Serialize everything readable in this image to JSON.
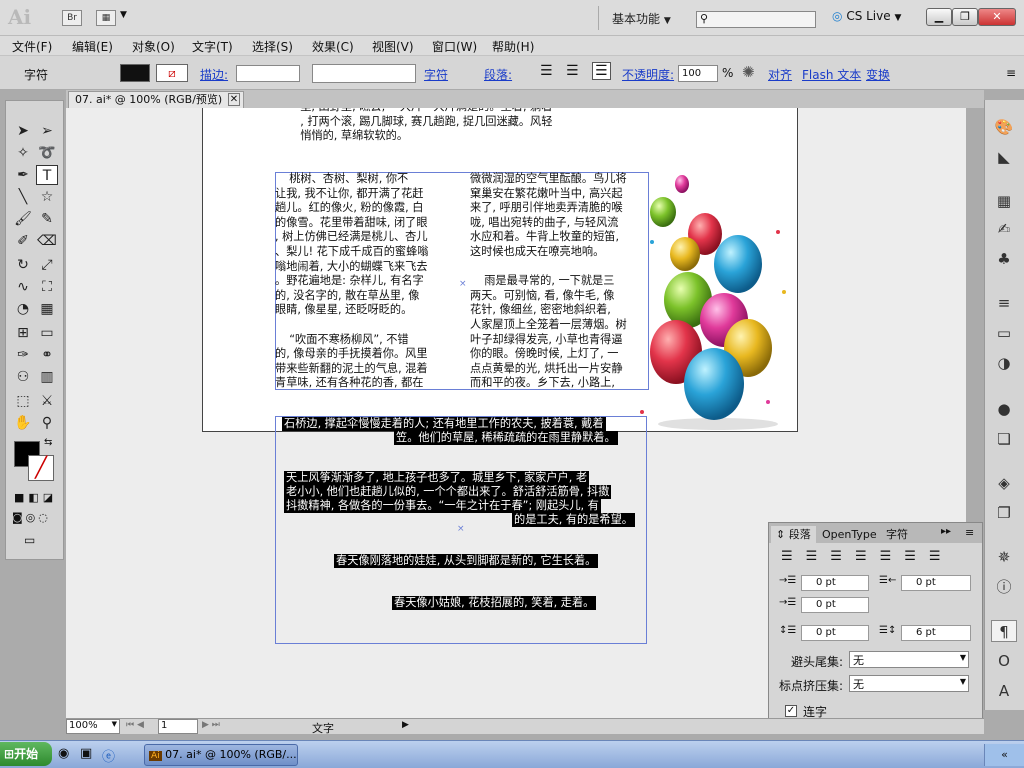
{
  "app": {
    "logo": "Ai",
    "br": "Br",
    "workspace": "基本功能",
    "cs_live": "CS Live"
  },
  "menu": [
    "文件(F)",
    "编辑(E)",
    "对象(O)",
    "文字(T)",
    "选择(S)",
    "效果(C)",
    "视图(V)",
    "窗口(W)",
    "帮助(H)"
  ],
  "control": {
    "label": "字符",
    "stroke": "描边:",
    "char_link": "字符",
    "para_link": "段落:",
    "opacity_label": "不透明度:",
    "opacity_value": "100",
    "pct": "%",
    "align": "对齐",
    "flash_text": "Flash 文本",
    "transform": "变换"
  },
  "doc_tab": "07. ai* @ 100% (RGB/预览)",
  "artboard_text": {
    "top": "    里, 田野里, 瞧去, 一大片一大片满是的。坐着, 躺着\n    , 打两个滚, 踢几脚球, 赛几趟跑, 捉几回迷藏。风轻\n    悄悄的, 草绵软软的。",
    "col1": "    桃树、杏树、梨树, 你不\n让我, 我不让你, 都开满了花赶\n趟儿。红的像火, 粉的像霞, 白\n的像雪。花里带着甜味, 闭了眼\n, 树上仿佛已经满是桃儿、杏儿\n、梨儿! 花下成千成百的蜜蜂嗡\n嗡地闹着, 大小的蝴蝶飞来飞去\n。野花遍地是: 杂样儿, 有名字\n的, 没名字的, 散在草丛里, 像\n眼睛, 像星星, 还眨呀眨的。\n\n    “吹面不寒杨柳风”, 不错\n的, 像母亲的手抚摸着你。风里\n带来些新翻的泥土的气息, 混着\n青草味, 还有各种花的香, 都在",
    "col2": "微微润湿的空气里酝酿。鸟儿将\n窠巢安在繁花嫩叶当中, 高兴起\n来了, 呼朋引伴地卖弄清脆的喉\n咙, 唱出宛转的曲子, 与轻风流\n水应和着。牛背上牧童的短笛,\n这时候也成天在嘹亮地响。\n\n    雨是最寻常的, 一下就是三\n两天。可别恼, 看, 像牛毛, 像\n花针, 像细丝, 密密地斜织着,\n人家屋顶上全笼着一层薄烟。树\n叶子却绿得发亮, 小草也青得逼\n你的眼。傍晚时候, 上灯了, 一\n点点黄晕的光, 烘托出一片安静\n而和平的夜。乡下去, 小路上,"
  },
  "overflow_text": [
    "石桥边, 撑起伞慢慢走着的人; 还有地里工作的农夫, 披着蓑, 戴着",
    "笠。他们的草屋, 稀稀疏疏的在雨里静默着。",
    "天上风筝渐渐多了, 地上孩子也多了。城里乡下, 家家户户, 老",
    "老小小, 他们也赶趟儿似的, 一个个都出来了。舒活舒活筋骨, 抖擞",
    "抖擞精神, 各做各的一份事去。“一年之计在于春”; 刚起头儿, 有",
    "的是工夫, 有的是希望。",
    "春天像刚落地的娃娃, 从头到脚都是新的, 它生长着。",
    "春天像小姑娘, 花枝招展的, 笑着, 走着。"
  ],
  "para_panel": {
    "tabs": [
      "段落",
      "OpenType",
      "字符"
    ],
    "indent_left": "0 pt",
    "indent_right": "0 pt",
    "first_line": "0 pt",
    "space_before": "0 pt",
    "space_after": "6 pt",
    "kinsoku_label": "避头尾集:",
    "kinsoku_value": "无",
    "mojikumi_label": "标点挤压集:",
    "mojikumi_value": "无",
    "hyphen_label": "连字"
  },
  "status": {
    "zoom": "100%",
    "page": "1",
    "mode": "文字"
  },
  "taskbar": {
    "start": "开始",
    "task": "07. ai* @ 100% (RGB/..."
  },
  "colors": {
    "accent": "#1a3cc9",
    "selection": "#6a7fd6",
    "taskbar": "#8aa8d8"
  }
}
